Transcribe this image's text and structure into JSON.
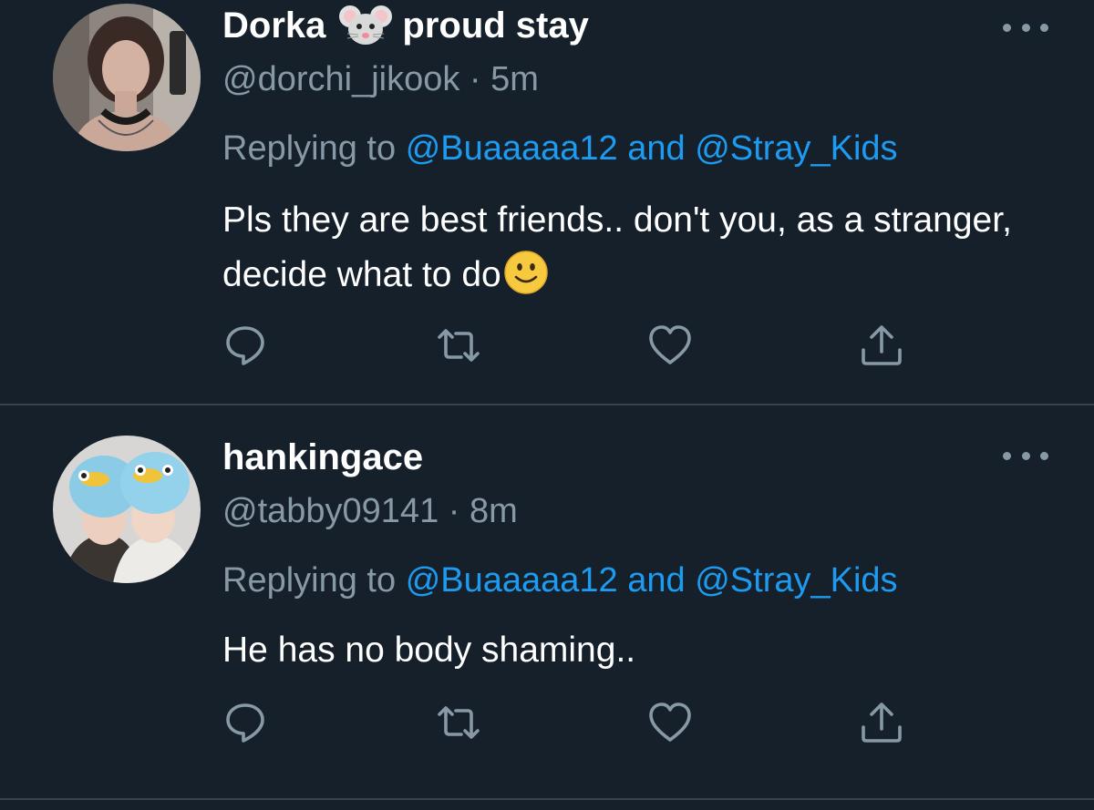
{
  "colors": {
    "background": "#15202b",
    "text_primary": "#ffffff",
    "text_secondary": "#8899a6",
    "mention": "#1d9bf0",
    "divider": "#38444d"
  },
  "tweets": [
    {
      "display_name_part1": "Dorka",
      "name_emoji": "mouse-face-emoji",
      "display_name_part2": "proud stay",
      "handle": "@dorchi_jikook",
      "separator": "·",
      "time": "5m",
      "replying_prefix": "Replying to",
      "replying_mention_1": "@Buaaaaa12",
      "replying_connector": "and",
      "replying_mention_2": "@Stray_Kids",
      "text": "Pls they are best friends.. don't you, as a stranger, decide what to do",
      "text_emoji": "slightly-smiling-face-emoji",
      "actions": [
        "reply-icon",
        "retweet-icon",
        "like-icon",
        "share-icon"
      ]
    },
    {
      "display_name": "hankingace",
      "handle": "@tabby09141",
      "separator": "·",
      "time": "8m",
      "replying_prefix": "Replying to",
      "replying_mention_1": "@Buaaaaa12",
      "replying_connector": "and",
      "replying_mention_2": "@Stray_Kids",
      "text": "He has no body shaming..",
      "actions": [
        "reply-icon",
        "retweet-icon",
        "like-icon",
        "share-icon"
      ]
    }
  ]
}
